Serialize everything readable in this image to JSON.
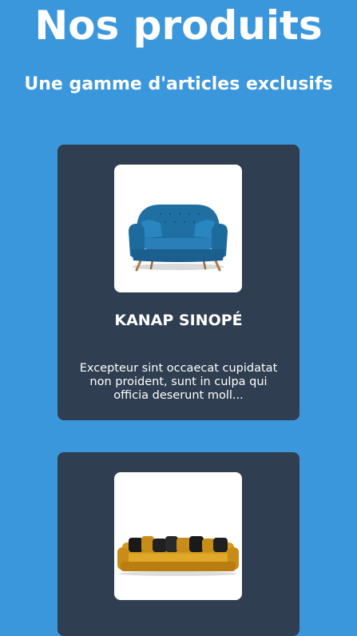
{
  "header": {
    "title": "Nos produits",
    "subtitle": "Une gamme d'articles exclusifs"
  },
  "products": [
    {
      "name": "KANAP SINOPÉ",
      "description": "Excepteur sint occaecat cupidatat non proident, sunt in culpa qui officia deserunt moll...",
      "image": "blue-sofa-image"
    },
    {
      "image": "yellow-sofa-image"
    }
  ],
  "colors": {
    "background": "#3b97dc",
    "card": "#2f3e50",
    "text": "#ffffff"
  }
}
